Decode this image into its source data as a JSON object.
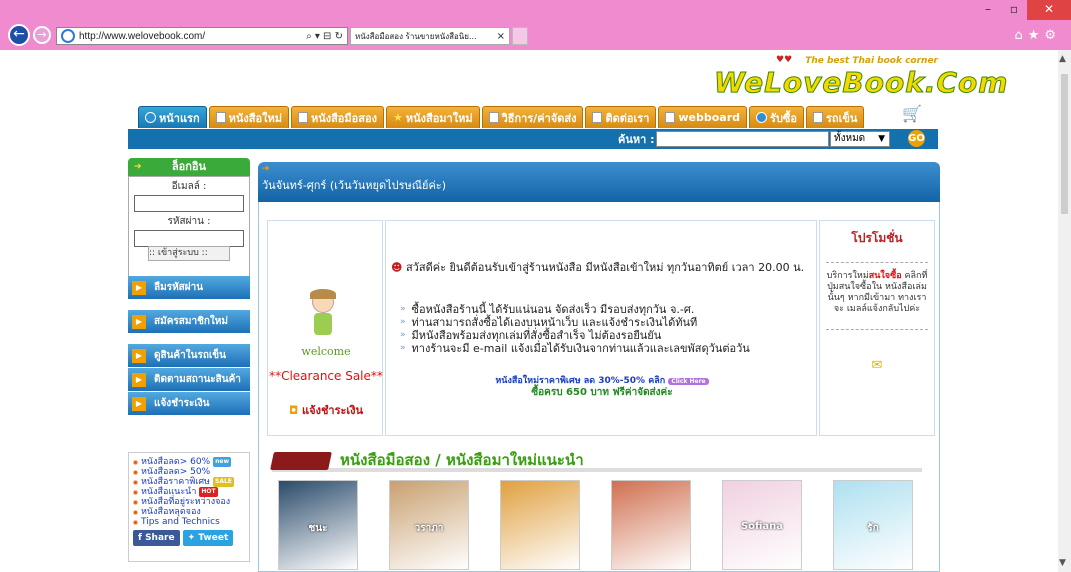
{
  "browser": {
    "url": "http://www.welovebook.com/",
    "tab_title": "หนังสือมือสอง ร้านขายหนังสือนิย...",
    "window_controls": [
      "minimize-icon",
      "restore-icon",
      "close-icon"
    ],
    "toolbar_icons": [
      "home-icon",
      "favorites-icon",
      "settings-icon"
    ]
  },
  "site": {
    "tagline": "The best Thai book corner",
    "logo": "WeLoveBook.Com"
  },
  "menu": [
    {
      "label": "หน้าแรก",
      "icon": "home-icon"
    },
    {
      "label": "หนังสือใหม่",
      "icon": "page-icon"
    },
    {
      "label": "หนังสือมือสอง",
      "icon": "page-icon"
    },
    {
      "label": "หนังสือมาใหม่",
      "icon": "star-icon"
    },
    {
      "label": "วิธีการ/ค่าจัดส่ง",
      "icon": "page-icon"
    },
    {
      "label": "ติดต่อเรา",
      "icon": "page-icon"
    },
    {
      "label": "webboard",
      "icon": "page-icon"
    },
    {
      "label": "รับซื้อ",
      "icon": "info-icon"
    },
    {
      "label": "รถเข็น",
      "icon": "cart-icon"
    }
  ],
  "search": {
    "label": "ค้นหา :",
    "category": "ทั้งหมด",
    "go_label": "GO"
  },
  "login": {
    "title": "ล็อกอิน",
    "email_label": "อีเมลล์ :",
    "password_label": "รหัสผ่าน :",
    "submit_label": ":: เข้าสู่ระบบ ::"
  },
  "sidebar_buttons": [
    "ลืมรหัสผ่าน",
    "สมัครสมาชิกใหม่",
    "ดูสินค้าในรถเข็น",
    "ติดตามสถานะสินค้า",
    "แจ้งชำระเงิน"
  ],
  "sidebar_links": [
    {
      "label": "หนังสือลด> 60%",
      "badge": "new"
    },
    {
      "label": "หนังสือลด> 50%",
      "badge": ""
    },
    {
      "label": "หนังสือราคาพิเศษ",
      "badge": "SALE"
    },
    {
      "label": "หนังสือแนะนำ",
      "badge": "HOT"
    },
    {
      "label": "หนังสือที่อยู่ระหว่างจอง",
      "badge": ""
    },
    {
      "label": "หนังสือหลุดจอง",
      "badge": ""
    },
    {
      "label": "Tips and Technics",
      "badge": ""
    }
  ],
  "social": {
    "share": "Share",
    "tweet": "Tweet"
  },
  "main": {
    "header": "วันจันทร์-ศุกร์ (เว้นวันหยุดไปรษณีย์ค่ะ)",
    "welcome_word": "welcome",
    "clearance": "**Clearance Sale**",
    "notify_payment": "แจ้งชำระเงิน",
    "greeting": "สวัสดีค่ะ ยินดีต้อนรับเข้าสู่ร้านหนังสือ มีหนังสือเข้าใหม่ ทุกวันอาทิตย์ เวลา 20.00 น.",
    "bullets": [
      "ซื้อหนังสือร้านนี้ ได้รับแน่นอน จัดส่งเร็ว มีรอบส่งทุกวัน จ.-ศ.",
      "ท่านสามารถสั่งซื้อได้เองบนหน้าเว็บ และแจ้งชำระเงินได้ทันที",
      "มีหนังสือพร้อมส่งทุกเล่มที่สั่งซื้อสำเร็จ ไม่ต้องรอยืนยัน",
      "ทางร้านจะมี e-mail แจ้งเมื่อได้รับเงินจากท่านแล้วและเลขพัสดุวันต่อวัน"
    ],
    "promo_line1": "หนังสือใหม่ราคาพิเศษ ลด 30%-50% คลิก",
    "promo_badge": "Click Here",
    "promo_line2": "ซื้อครบ 650 บาท ฟรีค่าจัดส่งค่ะ"
  },
  "promotion": {
    "title": "โปรโมชั่น",
    "text_before": "บริการใหม่",
    "text_highlight": "สนใจซื้อ",
    "text_after": "คลิกที่ปุ่มสนใจซื้อใน หนังสือเล่มนั้นๆ หากมีเข้ามา ทางเราจะ เมลล์แจ้งกลับไปค่ะ"
  },
  "section": {
    "title": "หนังสือมือสอง / หนังสือมาใหม่แนะนำ",
    "covers": [
      {
        "color": "#2a4a6a",
        "title": "ชนะ"
      },
      {
        "color": "#c9a070",
        "title": "วราภา"
      },
      {
        "color": "#e0a040",
        "title": ""
      },
      {
        "color": "#d07050",
        "title": ""
      },
      {
        "color": "#f0d0e0",
        "title": "Sofiana"
      },
      {
        "color": "#aee0f0",
        "title": "รัก"
      }
    ]
  }
}
